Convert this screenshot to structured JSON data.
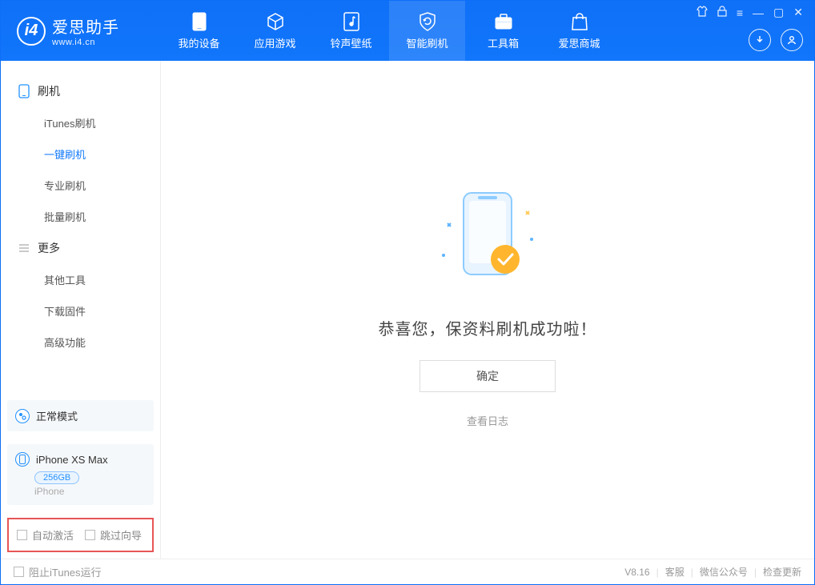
{
  "app": {
    "name": "爱思助手",
    "url": "www.i4.cn"
  },
  "nav": {
    "mydevice": "我的设备",
    "apps": "应用游戏",
    "ringwall": "铃声壁纸",
    "flash": "智能刷机",
    "toolbox": "工具箱",
    "store": "爱思商城"
  },
  "sidebar": {
    "section_flash": "刷机",
    "items_flash": {
      "itunes": "iTunes刷机",
      "oneclick": "一键刷机",
      "pro": "专业刷机",
      "batch": "批量刷机"
    },
    "section_more": "更多",
    "items_more": {
      "other": "其他工具",
      "firmware": "下载固件",
      "advanced": "高级功能"
    }
  },
  "device": {
    "mode": "正常模式",
    "name": "iPhone XS Max",
    "storage": "256GB",
    "type": "iPhone"
  },
  "checks": {
    "auto_activate": "自动激活",
    "skip_wizard": "跳过向导"
  },
  "main": {
    "success_text": "恭喜您，保资料刷机成功啦！",
    "confirm": "确定",
    "viewlog": "查看日志"
  },
  "footer": {
    "block_itunes": "阻止iTunes运行",
    "version": "V8.16",
    "support": "客服",
    "wechat": "微信公众号",
    "update": "检查更新"
  }
}
